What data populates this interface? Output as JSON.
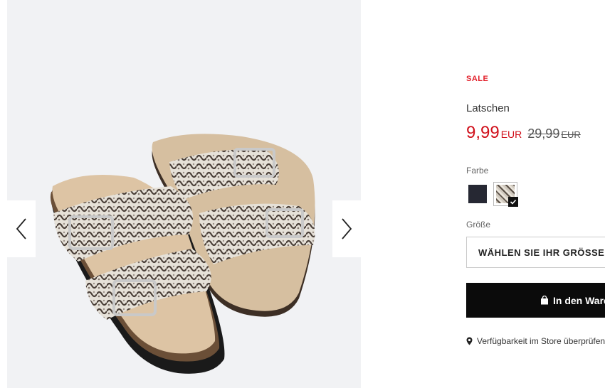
{
  "gallery": {
    "image_alt": "product-image",
    "prev_icon": "chevron-left-icon",
    "next_icon": "chevron-right-icon"
  },
  "product": {
    "badge": "SALE",
    "name": "Latschen",
    "price_current": "9,99",
    "currency_current": "EUR",
    "price_old": "29,99",
    "currency_old": "EUR",
    "colors": {
      "label": "Farbe",
      "options": [
        {
          "name": "black",
          "selected": false
        },
        {
          "name": "snake",
          "selected": true
        }
      ]
    },
    "size": {
      "label": "Größe",
      "placeholder": "WÄHLEN SIE IHR GRÖSSE"
    },
    "add_to_cart": {
      "label": "In den Warenkorb",
      "icon": "shopping-bag-icon"
    },
    "store_check": {
      "label": "Verfügbarkeit im Store überprüfen",
      "icon": "location-pin-icon"
    }
  },
  "colors": {
    "sale_red": "#e2202b",
    "price_red": "#d0101b",
    "button_bg": "#0b0b0b"
  }
}
